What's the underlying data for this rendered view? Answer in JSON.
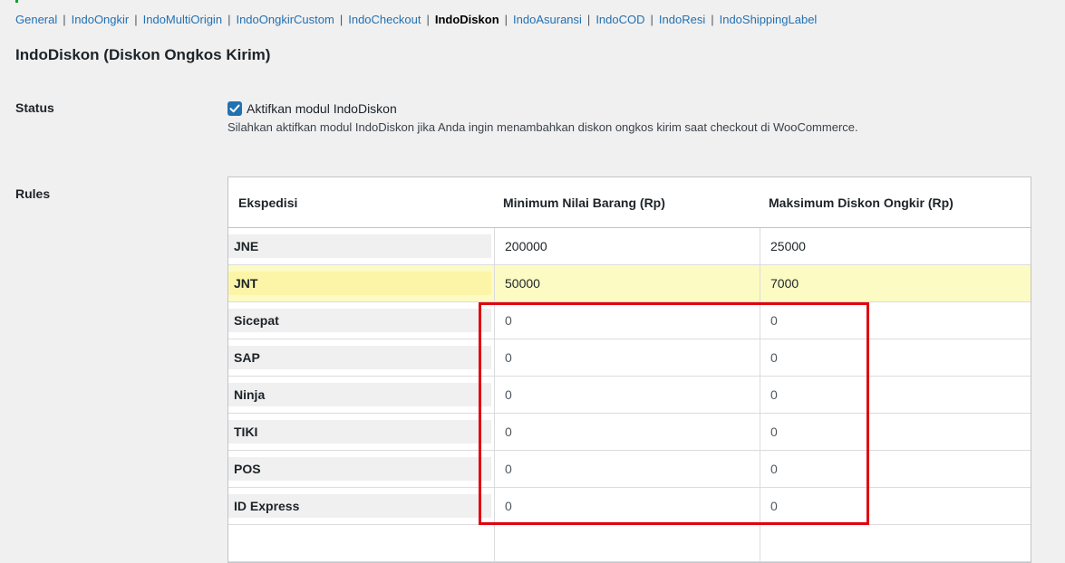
{
  "subnav": {
    "items": [
      {
        "label": "General"
      },
      {
        "label": "IndoOngkir"
      },
      {
        "label": "IndoMultiOrigin"
      },
      {
        "label": "IndoOngkirCustom"
      },
      {
        "label": "IndoCheckout"
      },
      {
        "label": "IndoDiskon",
        "current": true
      },
      {
        "label": "IndoAsuransi"
      },
      {
        "label": "IndoCOD"
      },
      {
        "label": "IndoResi"
      },
      {
        "label": "IndoShippingLabel"
      }
    ],
    "separator": "|"
  },
  "page": {
    "title": "IndoDiskon (Diskon Ongkos Kirim)"
  },
  "status": {
    "label": "Status",
    "checkbox_label": "Aktifkan modul IndoDiskon",
    "checked": true,
    "description": "Silahkan aktifkan modul IndoDiskon jika Anda ingin menambahkan diskon ongkos kirim saat checkout di WooCommerce."
  },
  "rules": {
    "label": "Rules",
    "columns": [
      "Ekspedisi",
      "Minimum Nilai Barang (Rp)",
      "Maksimum Diskon Ongkir (Rp)"
    ],
    "rows": [
      {
        "courier": "JNE",
        "min": "200000",
        "max": "25000"
      },
      {
        "courier": "JNT",
        "min": "50000",
        "max": "7000"
      },
      {
        "courier": "Sicepat",
        "min": "0",
        "max": "0"
      },
      {
        "courier": "SAP",
        "min": "0",
        "max": "0"
      },
      {
        "courier": "Ninja",
        "min": "0",
        "max": "0"
      },
      {
        "courier": "TIKI",
        "min": "0",
        "max": "0"
      },
      {
        "courier": "POS",
        "min": "0",
        "max": "0"
      },
      {
        "courier": "ID Express",
        "min": "0",
        "max": "0"
      }
    ]
  },
  "colors": {
    "accent": "#2271b1",
    "highlight_row": "#fdfbc4",
    "annotation_box": "#e1000f"
  },
  "icons": {
    "checkbox": "checkmark-icon"
  }
}
